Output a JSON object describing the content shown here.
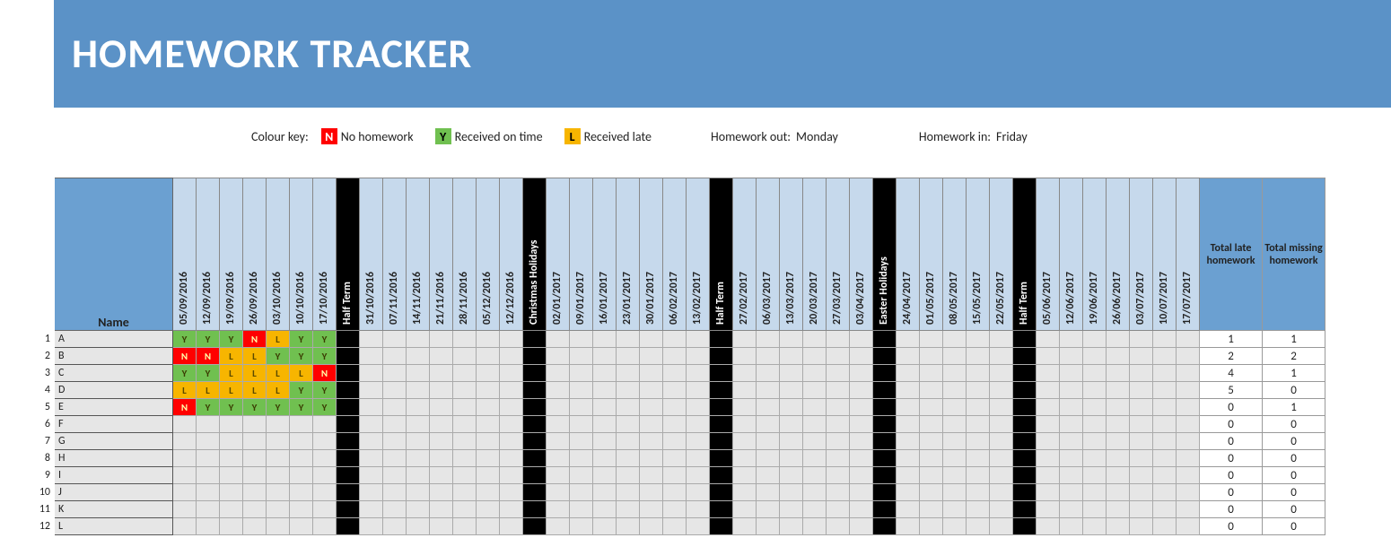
{
  "banner": {
    "title": "HOMEWORK TRACKER"
  },
  "legend": {
    "label": "Colour key:",
    "items": [
      {
        "code": "N",
        "text": "No homework",
        "class": "red"
      },
      {
        "code": "Y",
        "text": "Received on time",
        "class": "green"
      },
      {
        "code": "L",
        "text": "Received late",
        "class": "orange"
      }
    ],
    "hw_out_label": "Homework out:",
    "hw_out_value": "Monday",
    "hw_in_label": "Homework in:",
    "hw_in_value": "Friday"
  },
  "headers": {
    "name": "Name",
    "total_late": "Total late homework",
    "total_missing": "Total missing homework"
  },
  "columns": [
    {
      "label": "05/09/2016"
    },
    {
      "label": "12/09/2016"
    },
    {
      "label": "19/09/2016"
    },
    {
      "label": "26/09/2016"
    },
    {
      "label": "03/10/2016"
    },
    {
      "label": "10/10/2016"
    },
    {
      "label": "17/10/2016"
    },
    {
      "label": "Half Term",
      "break": true
    },
    {
      "label": "31/10/2016"
    },
    {
      "label": "07/11/2016"
    },
    {
      "label": "14/11/2016"
    },
    {
      "label": "21/11/2016"
    },
    {
      "label": "28/11/2016"
    },
    {
      "label": "05/12/2016"
    },
    {
      "label": "12/12/2016"
    },
    {
      "label": "Christmas Holidays",
      "break": true
    },
    {
      "label": "02/01/2017"
    },
    {
      "label": "09/01/2017"
    },
    {
      "label": "16/01/2017"
    },
    {
      "label": "23/01/2017"
    },
    {
      "label": "30/01/2017"
    },
    {
      "label": "06/02/2017"
    },
    {
      "label": "13/02/2017"
    },
    {
      "label": "Half Term",
      "break": true
    },
    {
      "label": "27/02/2017"
    },
    {
      "label": "06/03/2017"
    },
    {
      "label": "13/03/2017"
    },
    {
      "label": "20/03/2017"
    },
    {
      "label": "27/03/2017"
    },
    {
      "label": "03/04/2017"
    },
    {
      "label": "Easter Holidays",
      "break": true
    },
    {
      "label": "24/04/2017"
    },
    {
      "label": "01/05/2017"
    },
    {
      "label": "08/05/2017"
    },
    {
      "label": "15/05/2017"
    },
    {
      "label": "22/05/2017"
    },
    {
      "label": "Half Term",
      "break": true
    },
    {
      "label": "05/06/2017"
    },
    {
      "label": "12/06/2017"
    },
    {
      "label": "19/06/2017"
    },
    {
      "label": "26/06/2017"
    },
    {
      "label": "03/07/2017"
    },
    {
      "label": "10/07/2017"
    },
    {
      "label": "17/07/2017"
    }
  ],
  "rows": [
    {
      "n": 1,
      "name": "A",
      "marks": [
        "Y",
        "Y",
        "Y",
        "N",
        "L",
        "Y",
        "Y"
      ],
      "late": 1,
      "missing": 1
    },
    {
      "n": 2,
      "name": "B",
      "marks": [
        "N",
        "N",
        "L",
        "L",
        "Y",
        "Y",
        "Y"
      ],
      "late": 2,
      "missing": 2
    },
    {
      "n": 3,
      "name": "C",
      "marks": [
        "Y",
        "Y",
        "L",
        "L",
        "L",
        "L",
        "N"
      ],
      "late": 4,
      "missing": 1
    },
    {
      "n": 4,
      "name": "D",
      "marks": [
        "L",
        "L",
        "L",
        "L",
        "L",
        "Y",
        "Y"
      ],
      "late": 5,
      "missing": 0
    },
    {
      "n": 5,
      "name": "E",
      "marks": [
        "N",
        "Y",
        "Y",
        "Y",
        "Y",
        "Y",
        "Y"
      ],
      "late": 0,
      "missing": 1
    },
    {
      "n": 6,
      "name": "F",
      "marks": [],
      "late": 0,
      "missing": 0
    },
    {
      "n": 7,
      "name": "G",
      "marks": [],
      "late": 0,
      "missing": 0
    },
    {
      "n": 8,
      "name": "H",
      "marks": [],
      "late": 0,
      "missing": 0
    },
    {
      "n": 9,
      "name": "I",
      "marks": [],
      "late": 0,
      "missing": 0
    },
    {
      "n": 10,
      "name": "J",
      "marks": [],
      "late": 0,
      "missing": 0
    },
    {
      "n": 11,
      "name": "K",
      "marks": [],
      "late": 0,
      "missing": 0
    },
    {
      "n": 12,
      "name": "L",
      "marks": [],
      "late": 0,
      "missing": 0
    }
  ]
}
